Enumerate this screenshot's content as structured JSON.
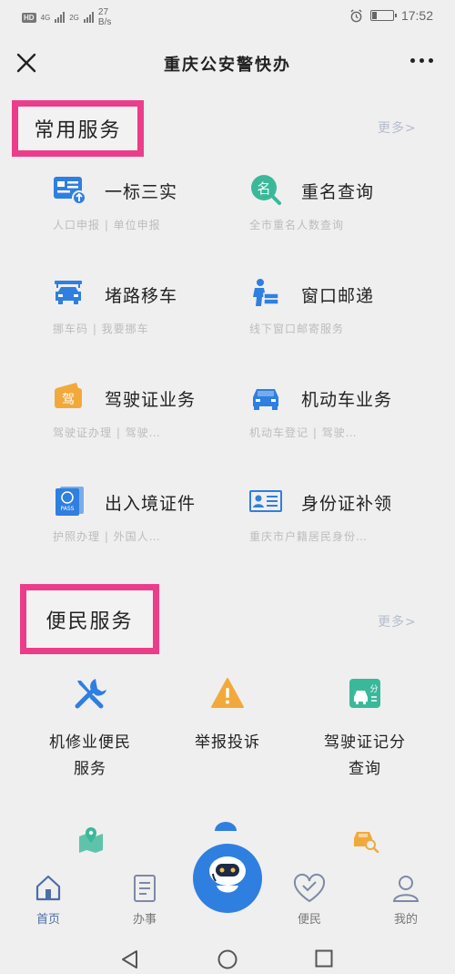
{
  "status_bar": {
    "hd": "HD",
    "net1": "4G",
    "net2": "2G",
    "rate_value": "27",
    "rate_unit": "B/s",
    "time": "17:52",
    "battery_level": 0.25
  },
  "titlebar": {
    "title": "重庆公安警快办"
  },
  "common_services": {
    "heading": "常用服务",
    "more": "更多>",
    "items": [
      {
        "title": "一标三实",
        "subtitle": "人口申报 | 单位申报",
        "icon": "id-card-icon"
      },
      {
        "title": "重名查询",
        "subtitle": "全市重名人数查询",
        "icon": "name-search-icon"
      },
      {
        "title": "堵路移车",
        "subtitle": "挪车码 | 我要挪车",
        "icon": "tow-car-icon"
      },
      {
        "title": "窗口邮递",
        "subtitle": "线下窗口邮寄服务",
        "icon": "courier-icon"
      },
      {
        "title": "驾驶证业务",
        "subtitle": "驾驶证办理 | 驾驶…",
        "icon": "driver-license-icon"
      },
      {
        "title": "机动车业务",
        "subtitle": "机动车登记 | 驾驶…",
        "icon": "car-icon"
      },
      {
        "title": "出入境证件",
        "subtitle": "护照办理 | 外国人…",
        "icon": "passport-icon"
      },
      {
        "title": "身份证补领",
        "subtitle": "重庆市户籍居民身份…",
        "icon": "id-reissue-icon"
      }
    ]
  },
  "convenience": {
    "heading": "便民服务",
    "more": "更多>",
    "items": [
      {
        "line1": "机修业便民",
        "line2": "服务",
        "icon": "repair-tools-icon"
      },
      {
        "line1": "举报投诉",
        "line2": "",
        "icon": "warning-icon"
      },
      {
        "line1": "驾驶证记分",
        "line2": "查询",
        "icon": "points-query-icon"
      }
    ]
  },
  "bottom_nav": {
    "items": [
      {
        "label": "首页",
        "icon": "home-icon",
        "active": true
      },
      {
        "label": "办事",
        "icon": "document-icon",
        "active": false
      },
      {
        "label": "便民",
        "icon": "heart-icon",
        "active": false
      },
      {
        "label": "我的",
        "icon": "person-icon",
        "active": false
      }
    ],
    "assistant_icon": "robot-assistant-icon"
  },
  "colors": {
    "accent_blue": "#2f7fe0",
    "highlight_pink": "#ec3d8a",
    "orange": "#f2a93b",
    "teal": "#3bb89a"
  }
}
